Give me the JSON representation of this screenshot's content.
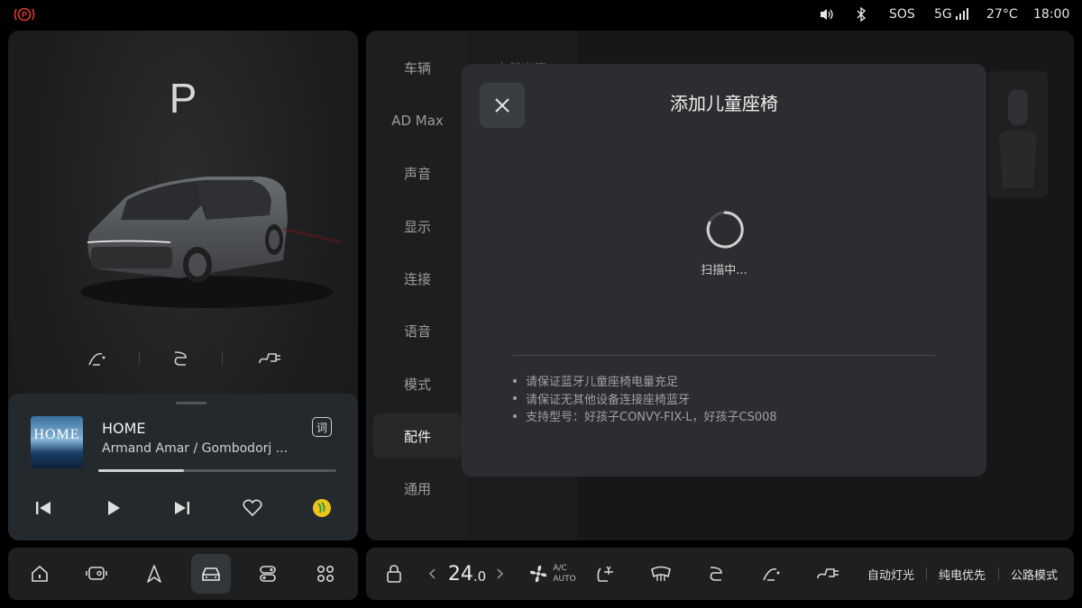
{
  "status_bar": {
    "parking_brake_icon": "parking-brake-icon",
    "sos": "SOS",
    "network": "5G",
    "temperature": "27°C",
    "time": "18:00"
  },
  "vehicle": {
    "gear": "P"
  },
  "media": {
    "album_title": "HOME",
    "song_title": "HOME",
    "artist": "Armand Amar / Gombodorj ...",
    "lyrics_label": "词",
    "progress": 0.36
  },
  "settings_nav": {
    "items": [
      {
        "label": "车辆"
      },
      {
        "label": "AD Max"
      },
      {
        "label": "声音"
      },
      {
        "label": "显示"
      },
      {
        "label": "连接"
      },
      {
        "label": "语音"
      },
      {
        "label": "模式"
      },
      {
        "label": "配件",
        "active": true
      },
      {
        "label": "通用"
      }
    ],
    "background_header": "自然出笔"
  },
  "dialog": {
    "title": "添加儿童座椅",
    "status": "扫描中...",
    "tips": [
      "请保证蓝牙儿童座椅电量充足",
      "请保证无其他设备连接座椅蓝牙",
      "支持型号：好孩子CONVY-FIX-L，好孩子CS008"
    ]
  },
  "dock": {
    "items": [
      "home-icon",
      "screen-icon",
      "navigation-icon",
      "car-icon",
      "apps-toggle-icon",
      "grid-icon"
    ],
    "active_index": 3
  },
  "climate": {
    "temperature_int": "24",
    "temperature_dec": ".0",
    "ac_label_top": "A/C",
    "ac_label_bottom": "AUTO",
    "auto_lights": "自动灯光",
    "ev_priority": "纯电优先",
    "road_mode": "公路模式"
  },
  "colors": {
    "background": "#000000",
    "panel": "#1d1f21",
    "dialog": "#2b2d30",
    "accent_red": "#e03b2c",
    "music_app_green": "#f0c21a"
  }
}
